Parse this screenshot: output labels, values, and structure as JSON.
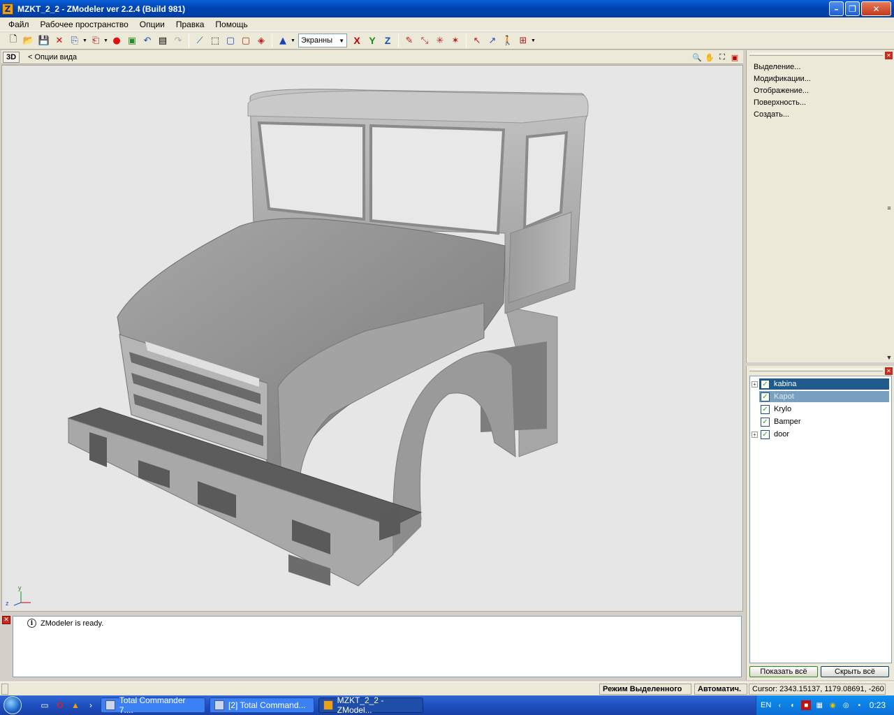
{
  "window": {
    "title": "MZKT_2_2 - ZModeler ver 2.2.4 (Build 981)",
    "app_icon_letter": "Z"
  },
  "menu": {
    "items": [
      "Файл",
      "Рабочее пространство",
      "Опции",
      "Правка",
      "Помощь"
    ]
  },
  "toolbar": {
    "view_select": "Экранны",
    "axis_x": "X",
    "axis_y": "Y",
    "axis_z": "Z"
  },
  "viewport": {
    "mode_label": "3D",
    "options_label": "<  Опции вида",
    "gizmo_y": "y",
    "gizmo_z": "z"
  },
  "log": {
    "message": "ZModeler is ready."
  },
  "right_panel": {
    "links": [
      "Выделение...",
      "Модификации...",
      "Отображение...",
      "Поверхность...",
      "Создать..."
    ]
  },
  "tree": {
    "items": [
      {
        "label": "kabina",
        "expandable": true,
        "checked": true,
        "state": "selected"
      },
      {
        "label": "Kapot",
        "expandable": false,
        "checked": true,
        "state": "highlight"
      },
      {
        "label": "Krylo",
        "expandable": false,
        "checked": true,
        "state": "normal"
      },
      {
        "label": "Bamper",
        "expandable": false,
        "checked": true,
        "state": "normal"
      },
      {
        "label": "door",
        "expandable": true,
        "checked": true,
        "state": "normal"
      }
    ],
    "show_all": "Показать всё",
    "hide_all": "Скрыть всё"
  },
  "status": {
    "mode": "Режим Выделенного",
    "auto": "Автоматич.",
    "cursor": "Cursor: 2343.15137, 1179.08691, -260"
  },
  "taskbar": {
    "tasks": [
      "Total Commander 7....",
      "[2] Total Command...",
      "MZKT_2_2 - ZModel..."
    ],
    "lang": "EN",
    "clock": "0:23"
  }
}
